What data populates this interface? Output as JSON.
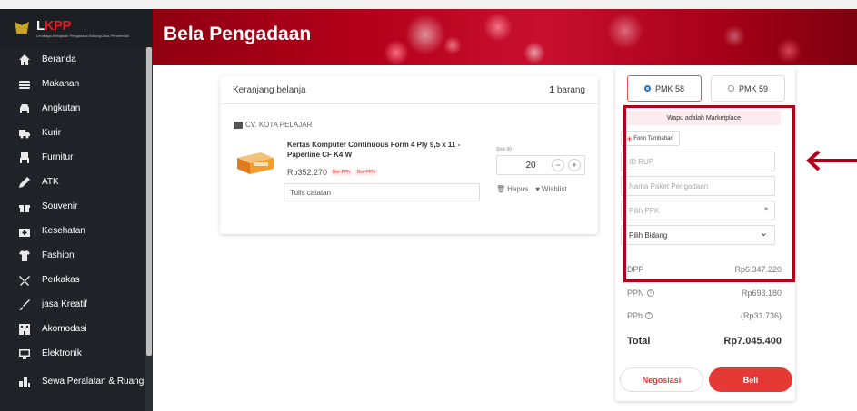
{
  "brand": {
    "name_a": "L",
    "name_b": "KPP",
    "subtitle": "Lembaga Kebijakan Pengadaan Barang/Jasa Pemerintah"
  },
  "header": {
    "title": "Bela Pengadaan"
  },
  "sidebar": {
    "items": [
      {
        "label": "Beranda",
        "icon": "home-icon"
      },
      {
        "label": "Makanan",
        "icon": "food-icon"
      },
      {
        "label": "Angkutan",
        "icon": "car-icon"
      },
      {
        "label": "Kurir",
        "icon": "truck-icon"
      },
      {
        "label": "Furnitur",
        "icon": "chair-icon"
      },
      {
        "label": "ATK",
        "icon": "pen-icon"
      },
      {
        "label": "Souvenir",
        "icon": "gift-icon"
      },
      {
        "label": "Kesehatan",
        "icon": "medical-icon"
      },
      {
        "label": "Fashion",
        "icon": "shirt-icon"
      },
      {
        "label": "Perkakas",
        "icon": "tools-icon"
      },
      {
        "label": "jasa Kreatif",
        "icon": "brush-icon"
      },
      {
        "label": "Akomodasi",
        "icon": "building-icon"
      },
      {
        "label": "Elektronik",
        "icon": "monitor-icon"
      },
      {
        "label": "Sewa Peralatan & Ruang",
        "icon": "city-icon"
      }
    ]
  },
  "cart": {
    "title": "Keranjang belanja",
    "count_num": "1",
    "count_unit": "barang",
    "seller": "CV. KOTA PELAJAR",
    "product": {
      "name": "Kertas Komputer Continuous Form 4 Ply 9,5 x 11 - Paperline CF K4 W",
      "price": "Rp352.270",
      "badge_pph": "Ber-PPh",
      "badge_ppn": "Ber-PPN",
      "stock": "Stok 90",
      "quantity": "20",
      "minus": "−",
      "plus": "+",
      "notes_placeholder": "Tulis catatan",
      "delete": "Hapus",
      "wishlist": "Wishlist"
    }
  },
  "panel": {
    "tabs": [
      {
        "label": "PMK 58",
        "selected": true
      },
      {
        "label": "PMK 59",
        "selected": false
      }
    ],
    "notice": "Wapu adalah Marketplace",
    "form_add": "Form Tambahan",
    "id_rup_placeholder": "ID RUP",
    "paket_placeholder": "Nama Paket Pengadaan",
    "ppk_placeholder": "Pilih PPK",
    "bidang_value": "Pilih Bidang",
    "dpp_label": "DPP",
    "dpp_value": "Rp6.347.220",
    "ppn_label": "PPN",
    "ppn_value": "Rp698.180",
    "pph_label": "PPh",
    "pph_value": "(Rp31.736)",
    "total_label": "Total",
    "total_value": "Rp7.045.400",
    "negotiate": "Negosiasi",
    "buy": "Beli"
  },
  "colors": {
    "accent": "#e53935",
    "highlight": "#b3001a",
    "sidebar": "#202428"
  }
}
